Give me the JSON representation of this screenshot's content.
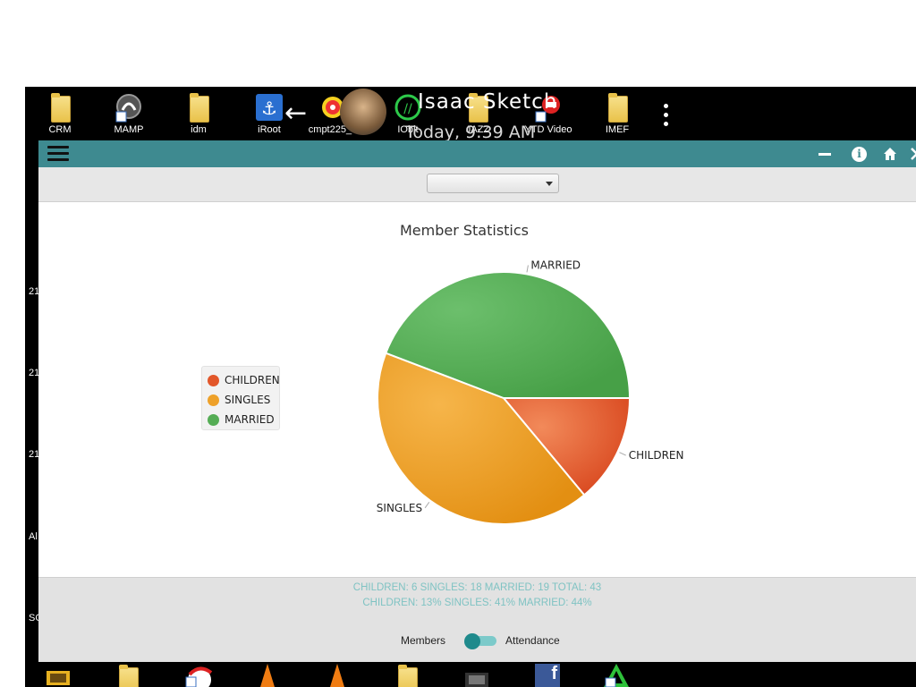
{
  "desktop": {
    "icons": [
      {
        "label": "CRM",
        "icon": "folder-icon"
      },
      {
        "label": "MAMP",
        "icon": "mamp-icon"
      },
      {
        "label": "idm",
        "icon": "folder-icon"
      },
      {
        "label": "iRoot",
        "icon": "anchor-icon"
      },
      {
        "label": "cmpt225_4",
        "icon": "app-icon"
      },
      {
        "label": "IObit",
        "icon": "iobit-icon"
      },
      {
        "label": "JAZZ",
        "icon": "folder-icon"
      },
      {
        "label": "YTD Video",
        "icon": "ytd-icon"
      },
      {
        "label": "IMEF",
        "icon": "folder-icon"
      }
    ],
    "left_edge_text": [
      "21",
      "21",
      "21",
      "Al",
      "SC"
    ],
    "overlay": {
      "title": "Isaac Sketch",
      "subtitle": "Today, 9:39 AM"
    }
  },
  "app": {
    "appbar": {
      "menu_icon": "hamburger-icon",
      "actions": [
        "minimize-icon",
        "info-icon",
        "home-icon",
        "close-icon"
      ],
      "accent_color": "#3e8a90"
    },
    "toolbar": {
      "select_value": ""
    },
    "chart_data": {
      "type": "pie",
      "title": "Member Statistics",
      "slices": [
        {
          "label": "CHILDREN",
          "value": 6,
          "color": "#e2572a"
        },
        {
          "label": "SINGLES",
          "value": 18,
          "color": "#eea12a"
        },
        {
          "label": "MARRIED",
          "value": 19,
          "color": "#55ad55"
        }
      ],
      "legend": {
        "placement": "left",
        "entries": [
          "CHILDREN",
          "SINGLES",
          "MARRIED"
        ]
      }
    },
    "stats": {
      "counts_line": "CHILDREN: 6 SINGLES: 18 MARRIED: 19 TOTAL: 43",
      "percent_line": "CHILDREN: 13% SINGLES: 41% MARRIED: 44%"
    },
    "footer": {
      "left_label": "Members",
      "right_label": "Attendance",
      "toggle_on": false
    }
  },
  "taskbar": {
    "icons": [
      "image-icon",
      "folder-icon",
      "browser-icon",
      "vlc-icon",
      "vlc-icon",
      "folder-icon",
      "film-icon",
      "facebook-icon",
      "arrow-app-icon"
    ]
  }
}
